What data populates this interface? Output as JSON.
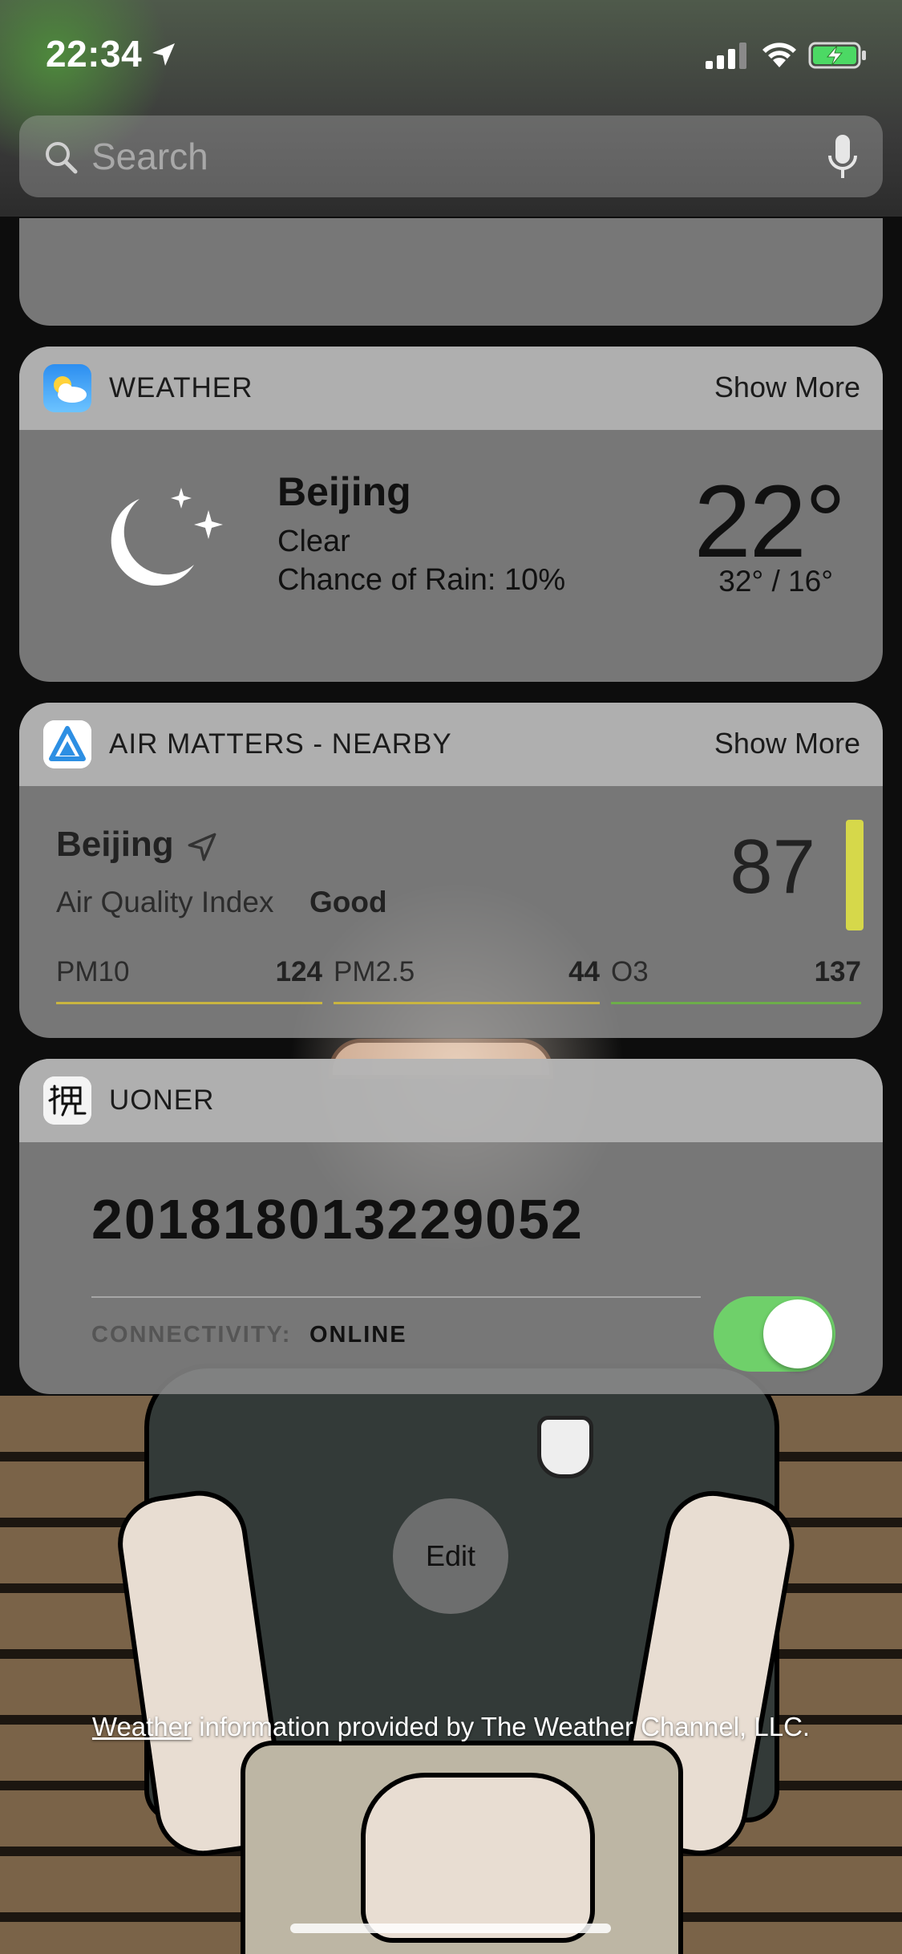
{
  "status_bar": {
    "time": "22:34",
    "icons": [
      "location-arrow-icon",
      "cellular-signal-icon",
      "wifi-icon",
      "battery-charging-icon"
    ]
  },
  "search": {
    "placeholder": "Search"
  },
  "weather_widget": {
    "title": "WEATHER",
    "show_more": "Show More",
    "city": "Beijing",
    "condition": "Clear",
    "rain": "Chance of Rain: 10%",
    "temperature": "22°",
    "range": "32° / 16°",
    "icon": "moon-stars-icon"
  },
  "air_widget": {
    "title": "AIR MATTERS - NEARBY",
    "show_more": "Show More",
    "city": "Beijing",
    "aqi_label": "Air Quality Index",
    "aqi_status": "Good",
    "aqi_value": "87",
    "aqi_color": "#d6d84a",
    "pollutants": [
      {
        "name": "PM10",
        "value": "124",
        "color": "#c9b540"
      },
      {
        "name": "PM2.5",
        "value": "44",
        "color": "#c9b540"
      },
      {
        "name": "O3",
        "value": "137",
        "color": "#6dae4a"
      }
    ]
  },
  "uoner_widget": {
    "title": "UONER",
    "number": "201818013229052",
    "connectivity_label": "CONNECTIVITY:",
    "connectivity_value": "ONLINE",
    "toggle_on": true,
    "toggle_color": "#6fd06a"
  },
  "edit_label": "Edit",
  "footer": {
    "link": "Weather",
    "text": " information provided by The Weather Channel, LLC."
  }
}
